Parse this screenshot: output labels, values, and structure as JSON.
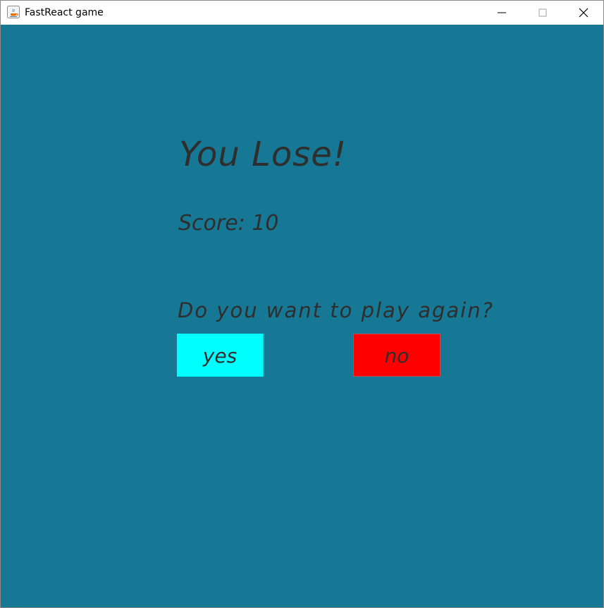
{
  "window": {
    "title": "FastReact game",
    "icon": "java-app-icon",
    "controls": [
      "minimize-icon",
      "maximize-icon",
      "close-icon"
    ]
  },
  "game_over": {
    "headline": "You Lose!",
    "score_text": "Score: 10",
    "question": "Do you want to play again?",
    "yes_label": "yes",
    "no_label": "no"
  },
  "colors": {
    "background": "#167894",
    "text": "#2e2e2e",
    "yes_button": "#00ffff",
    "no_button": "#ff0000"
  }
}
